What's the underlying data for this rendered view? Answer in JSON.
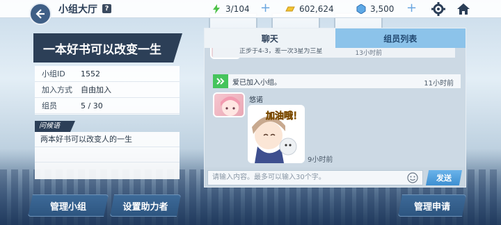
{
  "header": {
    "title": "小组大厅",
    "help_label": "?",
    "stamina": "3/104",
    "gold": "602,624",
    "gems": "3,500",
    "plus_label": "+"
  },
  "group": {
    "name": "一本好书可以改变一生",
    "info": [
      {
        "key": "小组ID",
        "value": "1552"
      },
      {
        "key": "加入方式",
        "value": "自由加入"
      },
      {
        "key": "组员",
        "value": "5 / 30"
      }
    ],
    "greeting_label": "问候语",
    "greeting": "两本好书可以改变人的一生"
  },
  "buttons": {
    "manage_group": "管理小组",
    "set_helper": "设置助力者",
    "manage_requests": "管理申请"
  },
  "chat": {
    "tabs": [
      {
        "label": "聊天",
        "active": true
      },
      {
        "label": "组员列表",
        "active": false
      }
    ],
    "prev_message": "正步于4-3，差一次3星为三星",
    "prev_time": "13小时前",
    "system_message": "爱已加入小组。",
    "system_time": "11小时前",
    "user_name": "悠诺",
    "sticker_text": "加油哦！",
    "message_time": "9小时前",
    "input_placeholder": "请输入内容。最多可以输入30个字。",
    "send_label": "发送"
  },
  "colors": {
    "accent_blue": "#3e8fd1",
    "panel_dark": "#2c3f57",
    "system_green": "#45c45c",
    "tab_inactive": "#8cc3ea"
  }
}
